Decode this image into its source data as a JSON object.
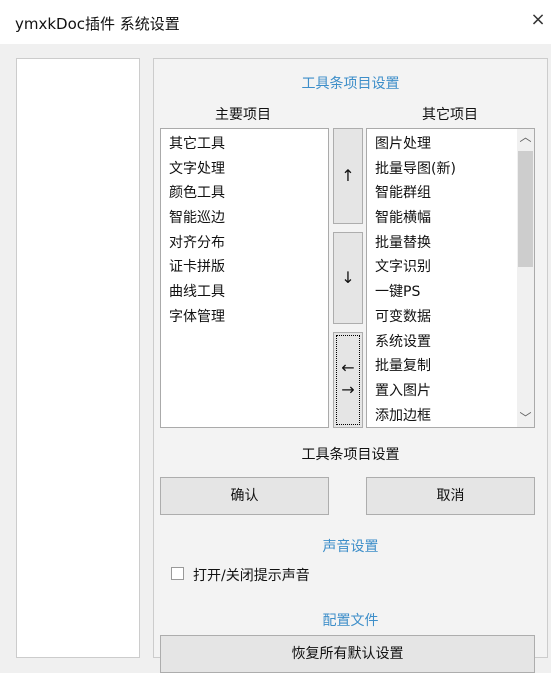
{
  "window": {
    "title": "ymxkDoc插件 系统设置",
    "close_glyph": "×"
  },
  "toolbar_section": {
    "title": "工具条项目设置",
    "main_label": "主要项目",
    "other_label": "其它项目",
    "main_items": [
      "其它工具",
      "文字处理",
      "颜色工具",
      "智能巡边",
      "对齐分布",
      "证卡拼版",
      "曲线工具",
      "字体管理"
    ],
    "other_items": [
      "图片处理",
      "批量导图(新)",
      "智能群组",
      "智能横幅",
      "批量替换",
      "文字识别",
      "一键PS",
      "可变数据",
      "系统设置",
      "批量复制",
      "置入图片",
      "添加边框"
    ],
    "move_up_glyph": "↑",
    "move_down_glyph": "↓",
    "swap_left_glyph": "←",
    "swap_right_glyph": "→",
    "scroll_up_glyph": "︿",
    "scroll_down_glyph": "﹀",
    "caption": "工具条项目设置",
    "confirm_label": "确认",
    "cancel_label": "取消"
  },
  "sound_section": {
    "title": "声音设置",
    "toggle_label": "打开/关闭提示声音",
    "checked": false
  },
  "config_section": {
    "title": "配置文件",
    "restore_label": "恢复所有默认设置"
  },
  "colors": {
    "section_title": "#3d8ec9",
    "window_bg": "#f0f0f0",
    "button_bg": "#e5e5e5"
  }
}
